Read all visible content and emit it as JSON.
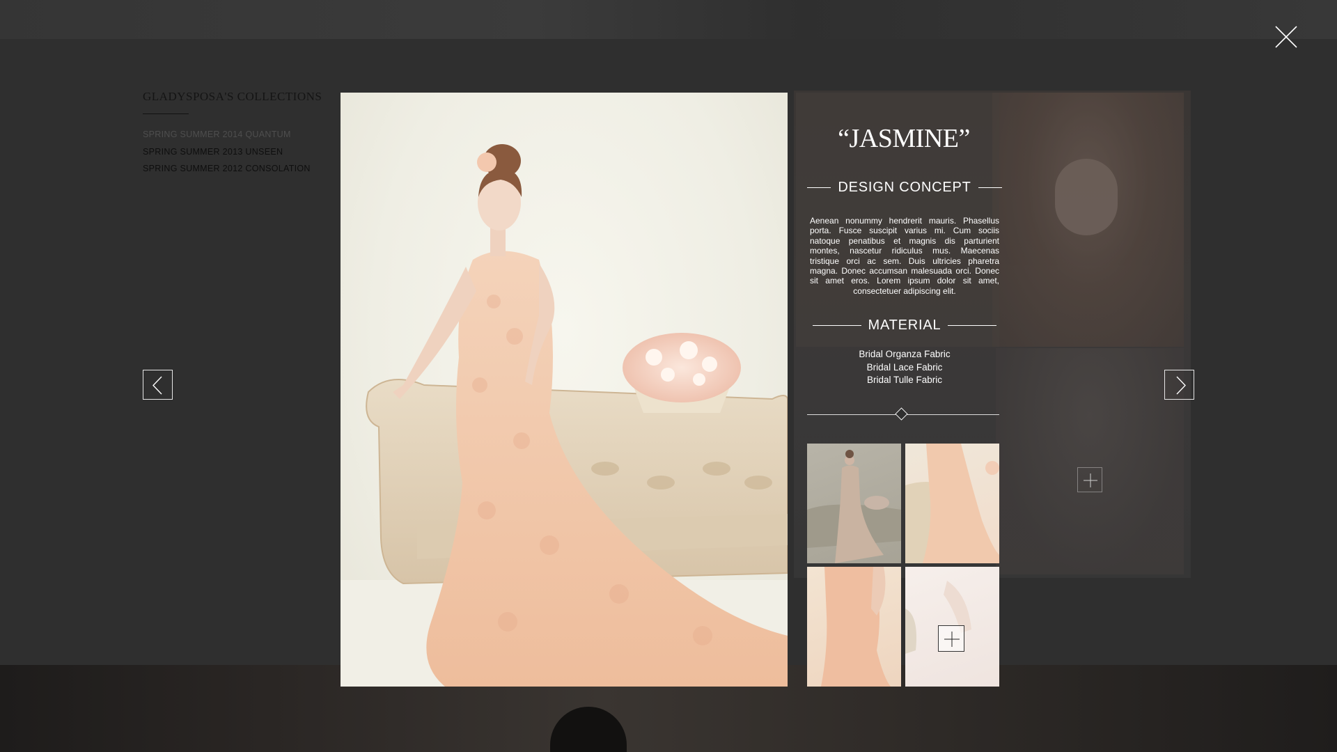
{
  "close": {
    "icon": "close-icon"
  },
  "sidebar": {
    "title": "GLADYSPOSA'S COLLECTIONS",
    "items": [
      {
        "label": "SPRING SUMMER 2014 QUANTUM"
      },
      {
        "label": "SPRING SUMMER 2013 UNSEEN"
      },
      {
        "label": "SPRING SUMMER 2012 CONSOLATION"
      }
    ]
  },
  "navigation": {
    "prev_icon": "chevron-left-icon",
    "next_icon": "chevron-right-icon"
  },
  "detail": {
    "name": "“JASMINE”",
    "concept_heading": "DESIGN CONCEPT",
    "concept_text": "Aenean nonummy hendrerit mauris. Phasellus porta. Fusce suscipit varius mi. Cum sociis natoque penatibus et magnis dis parturient montes, nascetur ridiculus mus. Maecenas tristique orci ac sem. Duis ultricies pharetra magna. Donec accumsan malesuada orci. Donec sit amet eros. Lorem ipsum dolor sit amet, consectetuer adipiscing elit.",
    "material_heading": "MATERIAL",
    "materials": [
      "Bridal Organza Fabric",
      "Bridal Lace Fabric",
      "Bridal Tulle Fabric"
    ]
  },
  "thumbnails": {
    "expand_icon": "plus-icon"
  },
  "colors": {
    "overlay": "#2f2f2f",
    "text_dark": "#141414",
    "text_light": "#ffffff",
    "dress": "#f1cdb2"
  }
}
